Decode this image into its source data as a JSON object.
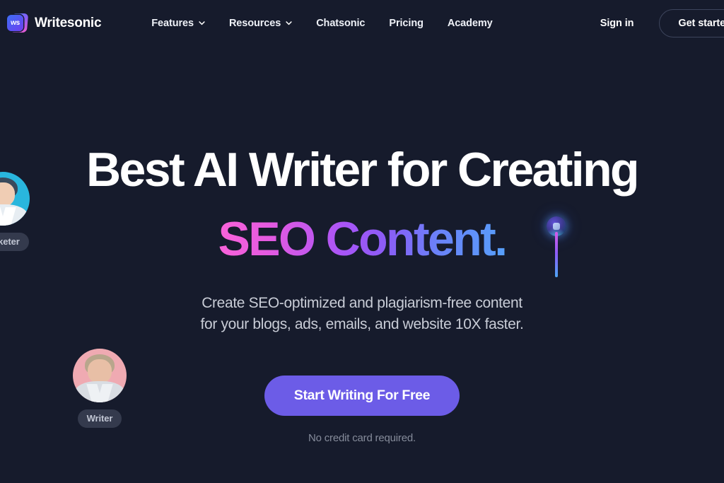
{
  "theme": {
    "background": "#161b2c",
    "accent_purple": "#6c5ce7",
    "gradient_start": "#fa63d9",
    "gradient_mid": "#8b5cf6",
    "gradient_end": "#56a0fa",
    "text_primary": "#ffffff",
    "text_muted": "#c8ccd6"
  },
  "header": {
    "brand": {
      "name": "Writesonic",
      "logo_text": "ws"
    },
    "nav": [
      {
        "label": "Features",
        "has_dropdown": true
      },
      {
        "label": "Resources",
        "has_dropdown": true
      },
      {
        "label": "Chatsonic",
        "has_dropdown": false
      },
      {
        "label": "Pricing",
        "has_dropdown": false
      },
      {
        "label": "Academy",
        "has_dropdown": false
      }
    ],
    "sign_in_label": "Sign in",
    "get_started_label": "Get started free"
  },
  "hero": {
    "headline_line1": "Best AI Writer for Creating",
    "headline_line2": "SEO Content.",
    "subtitle_line1": "Create SEO-optimized and plagiarism-free content",
    "subtitle_line2": "for your blogs, ads, emails, and website 10X faster.",
    "cta_label": "Start Writing For Free",
    "cta_note": "No credit card required."
  },
  "personas": [
    {
      "label": "Marketer",
      "avatar_bg": "#29b6dd"
    },
    {
      "label": "Writer",
      "avatar_bg": "#efaab2"
    }
  ]
}
